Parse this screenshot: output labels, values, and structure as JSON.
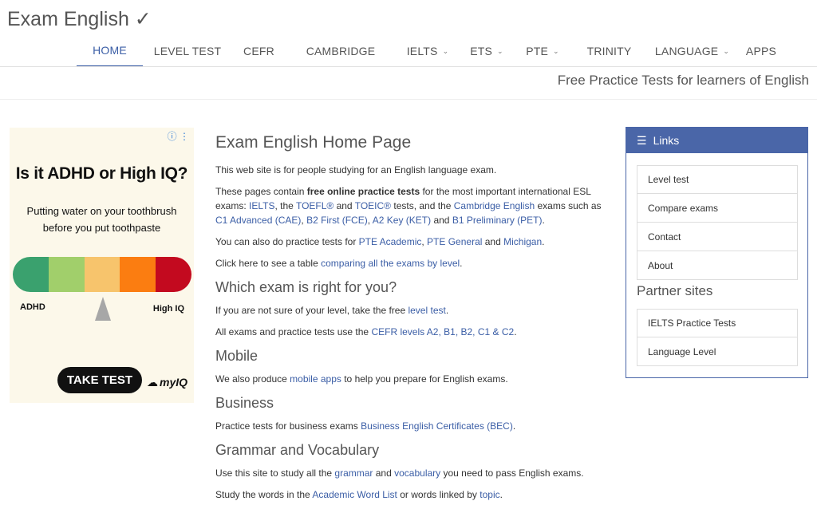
{
  "brand": "Exam English ✓",
  "nav": [
    {
      "label": "HOME",
      "chevron": false,
      "active": true,
      "w": 83
    },
    {
      "label": "LEVEL TEST",
      "chevron": false,
      "active": false,
      "w": 112
    },
    {
      "label": "CEFR",
      "chevron": false,
      "active": false,
      "w": 67
    },
    {
      "label": "CAMBRIDGE",
      "chevron": false,
      "active": false,
      "w": 138
    },
    {
      "label": "IELTS",
      "chevron": true,
      "active": false,
      "w": 80
    },
    {
      "label": "ETS",
      "chevron": true,
      "active": false,
      "w": 68
    },
    {
      "label": "PTE",
      "chevron": true,
      "active": false,
      "w": 72
    },
    {
      "label": "TRINITY",
      "chevron": false,
      "active": false,
      "w": 95
    },
    {
      "label": "LANGUAGE",
      "chevron": true,
      "active": false,
      "w": 113
    },
    {
      "label": "APPS",
      "chevron": false,
      "active": false,
      "w": 60
    }
  ],
  "tagline": "Free Practice Tests for learners of English",
  "ad": {
    "headline": "Is it ADHD or High IQ?",
    "sub_line1": "Putting water on your toothbrush",
    "sub_line2": "before you put toothpaste",
    "label_left": "ADHD",
    "label_right": "High IQ",
    "cta": "TAKE TEST",
    "logo": "myIQ",
    "info_icon": "info-icon",
    "meter_colors": [
      "#3aa16e",
      "#a1cf6b",
      "#f7c46c",
      "#fb7d11",
      "#c30a1f"
    ]
  },
  "main": {
    "title": "Exam English Home Page",
    "intro": "This web site is for people studying for an English language exam.",
    "p1_a": "These pages contain ",
    "p1_bold": "free online practice tests",
    "p1_b": " for the most important international ESL exams: ",
    "p1_link_ielts": "IELTS",
    "p1_c": ", the ",
    "p1_link_toefl": "TOEFL®",
    "p1_d": " and ",
    "p1_link_toeic": "TOEIC®",
    "p1_e": " tests, and the ",
    "p1_link_cambridge": "Cambridge English",
    "p1_f": " exams such as ",
    "p1_link_c1": "C1 Advanced (CAE)",
    "p1_g": ", ",
    "p1_link_b2": "B2 First (FCE)",
    "p1_h": ", ",
    "p1_link_a2": "A2 Key (KET)",
    "p1_i": " and ",
    "p1_link_b1": "B1 Preliminary (PET)",
    "p1_j": ".",
    "p2_a": "You can also do practice tests for ",
    "p2_link_pte_academic": "PTE Academic",
    "p2_b": ", ",
    "p2_link_pte_general": "PTE General",
    "p2_c": " and ",
    "p2_link_michigan": "Michigan",
    "p2_d": ".",
    "p3_a": "Click here to see a table ",
    "p3_link": "comparing all the exams by level",
    "p3_b": ".",
    "h_which": "Which exam is right for you?",
    "p4_a": "If you are not sure of your level, take the free ",
    "p4_link": "level test",
    "p4_b": ".",
    "p5_a": "All exams and practice tests use the ",
    "p5_link": "CEFR levels A2, B1, B2, C1 & C2",
    "p5_b": ".",
    "h_mobile": "Mobile",
    "p6_a": "We also produce ",
    "p6_link": "mobile apps",
    "p6_b": " to help you prepare for English exams.",
    "h_business": "Business",
    "p7_a": "Practice tests for business exams ",
    "p7_link": "Business English Certificates (BEC)",
    "p7_b": ".",
    "h_grammar": "Grammar and Vocabulary",
    "p8_a": "Use this site to study all the ",
    "p8_link_grammar": "grammar",
    "p8_b": " and ",
    "p8_link_vocab": "vocabulary",
    "p8_c": " you need to pass English exams.",
    "p9_a": "Study the words in the ",
    "p9_link_awl": "Academic Word List",
    "p9_b": " or words linked by ",
    "p9_link_topic": "topic",
    "p9_c": "."
  },
  "sidebar": {
    "links_title": "Links",
    "links": [
      "Level test",
      "Compare exams",
      "Contact",
      "About"
    ],
    "partner_title": "Partner sites",
    "partners": [
      "IELTS Practice Tests",
      "Language Level"
    ]
  }
}
